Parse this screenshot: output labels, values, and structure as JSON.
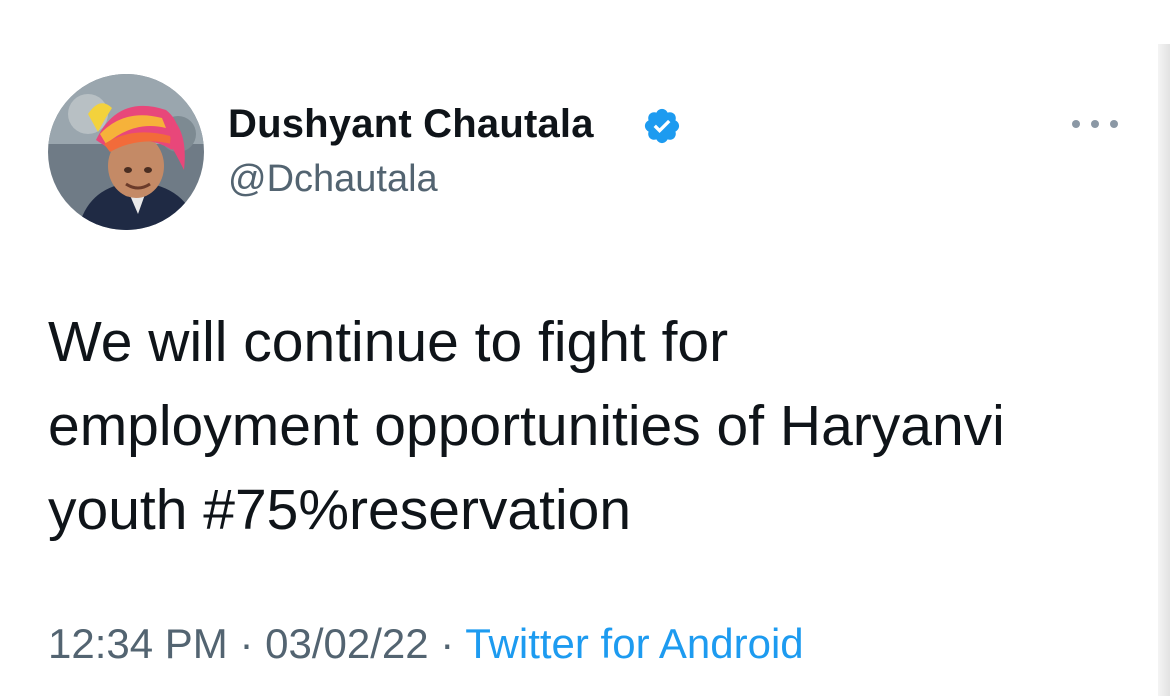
{
  "author": {
    "display_name": "Dushyant Chautala",
    "handle": "@Dchautala",
    "verified_icon": "verified-badge-icon"
  },
  "tweet": {
    "lines": [
      "We will continue to fight for",
      "employment opportunities of Haryanvi",
      "youth #75%reservation"
    ]
  },
  "meta": {
    "time": "12:34 PM",
    "sep1": " · ",
    "date": "03/02/22",
    "sep2": " · ",
    "source": "Twitter for Android"
  },
  "colors": {
    "text": "#0f1419",
    "secondary": "#536471",
    "link": "#1d9bf0",
    "verified": "#1d9bf0"
  }
}
